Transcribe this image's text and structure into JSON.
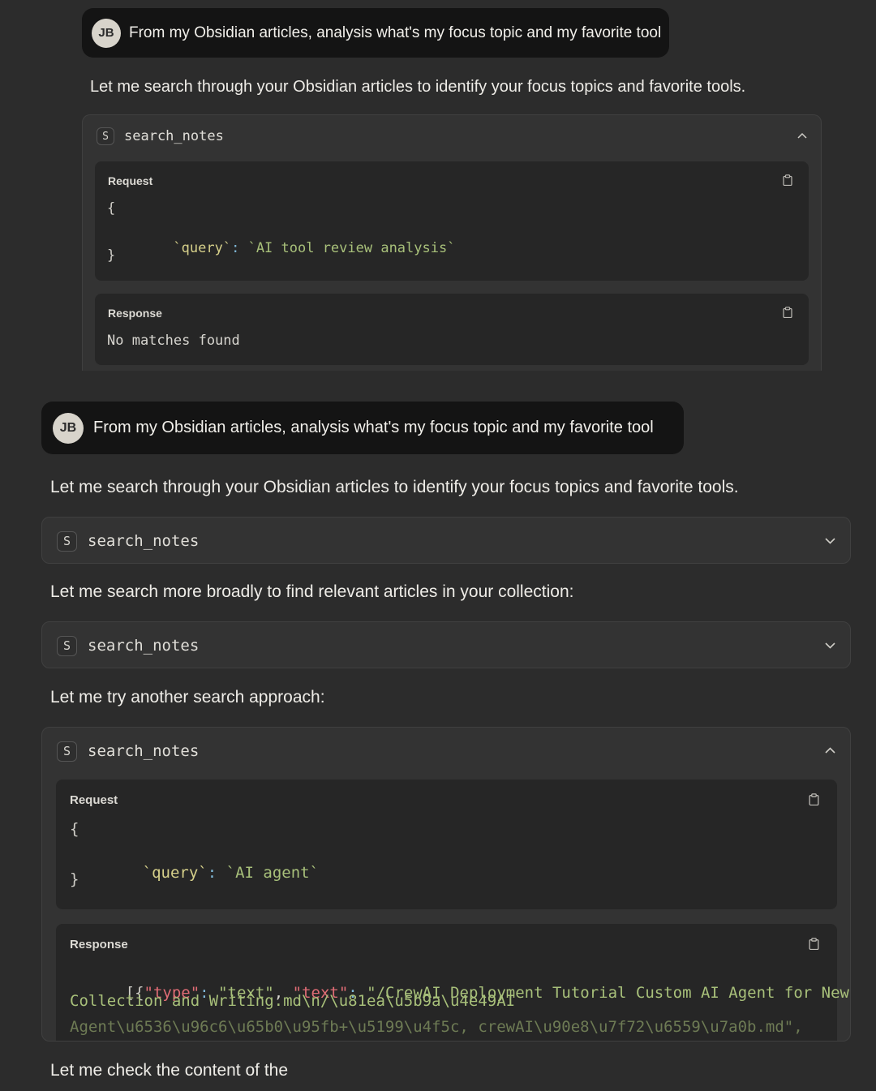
{
  "turn1": {
    "user": {
      "avatar": "JB",
      "text": "From my Obsidian articles, analysis what's my focus topic and my favorite tool"
    },
    "assistant_text": "Let me search through your Obsidian articles to identify your focus topics and favorite tools.",
    "tool": {
      "badge": "S",
      "name": "search_notes",
      "request_label": "Request",
      "request": {
        "open": "{",
        "key": "`query`",
        "colon": ":",
        "value": "`AI tool review analysis`",
        "close": "}"
      },
      "response_label": "Response",
      "response": "No matches found"
    }
  },
  "turn2": {
    "user": {
      "avatar": "JB",
      "text": "From my Obsidian articles, analysis what's my focus topic and my favorite tool"
    },
    "text1": "Let me search through your Obsidian articles to identify your focus topics and favorite tools.",
    "tool1": {
      "badge": "S",
      "name": "search_notes"
    },
    "text2": "Let me search more broadly to find relevant articles in your collection:",
    "tool2": {
      "badge": "S",
      "name": "search_notes"
    },
    "text3": "Let me try another search approach:",
    "tool3": {
      "badge": "S",
      "name": "search_notes",
      "request_label": "Request",
      "request": {
        "open": "{",
        "key": "`query`",
        "colon": ":",
        "value": "`AI agent`",
        "close": "}"
      },
      "response_label": "Response",
      "response": {
        "bracket": "[{",
        "k1": "\"type\"",
        "colon": ":",
        "v1": "\"text\"",
        "comma": ",",
        "k2": "\"text\"",
        "v2_line1": "\"/CrewAI Deployment Tutorial Custom AI Agent for News",
        "v2_line2": "Collection and Writing.md\\n/\\u81ea\\u5b9a\\u4e49AI",
        "v2_line3": "Agent\\u6536\\u96c6\\u65b0\\u95fb+\\u5199\\u4f5c, crewAI\\u90e8\\u7f72\\u6559\\u7a0b.md\","
      }
    },
    "text4": "Let me check the content of the"
  }
}
